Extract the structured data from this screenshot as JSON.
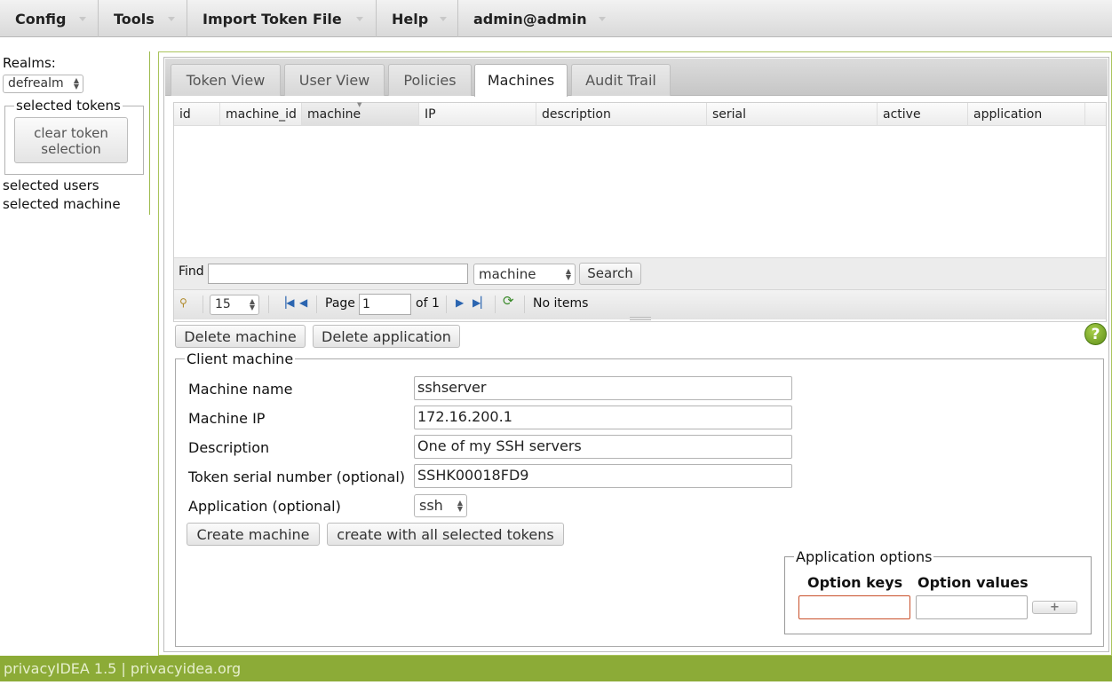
{
  "menu": {
    "items": [
      {
        "label": "Config"
      },
      {
        "label": "Tools"
      },
      {
        "label": "Import Token File"
      },
      {
        "label": "Help"
      },
      {
        "label": "admin@admin"
      }
    ]
  },
  "sidebar": {
    "realms_label": "Realms:",
    "realm_value": "defrealm",
    "selected_tokens_legend": "selected tokens",
    "clear_button_line1": "clear token",
    "clear_button_line2": "selection",
    "selected_users": "selected users",
    "selected_machine": "selected machine"
  },
  "tabs": [
    {
      "label": "Token View"
    },
    {
      "label": "User View"
    },
    {
      "label": "Policies"
    },
    {
      "label": "Machines",
      "active": true
    },
    {
      "label": "Audit Trail"
    }
  ],
  "grid": {
    "columns": [
      "id",
      "machine_id",
      "machine",
      "IP",
      "description",
      "serial",
      "active",
      "application"
    ],
    "rows": []
  },
  "find": {
    "label": "Find",
    "value": "",
    "field_select": "machine",
    "search_button": "Search"
  },
  "pager": {
    "per_page": "15",
    "page_label": "Page",
    "page_value": "1",
    "of_label": "of 1",
    "status": "No items"
  },
  "actions": {
    "delete_machine": "Delete machine",
    "delete_application": "Delete application",
    "help": "?"
  },
  "form": {
    "legend": "Client machine",
    "machine_name_label": "Machine name",
    "machine_name_value": "sshserver",
    "machine_ip_label": "Machine IP",
    "machine_ip_value": "172.16.200.1",
    "description_label": "Description",
    "description_value": "One of my SSH servers",
    "serial_label": "Token serial number (optional)",
    "serial_value": "SSHK00018FD9",
    "application_label": "Application (optional)",
    "application_value": "ssh",
    "create_button": "Create machine",
    "create_all_button": "create with all selected tokens"
  },
  "app_options": {
    "legend": "Application options",
    "keys_header": "Option keys",
    "values_header": "Option values",
    "key_value": "",
    "value_value": "",
    "add_button": "+"
  },
  "footer": {
    "text": "privacyIDEA 1.5 | privacyidea.org"
  },
  "colors": {
    "accent_green": "#8cab37",
    "help_green": "#6a9a1f"
  }
}
